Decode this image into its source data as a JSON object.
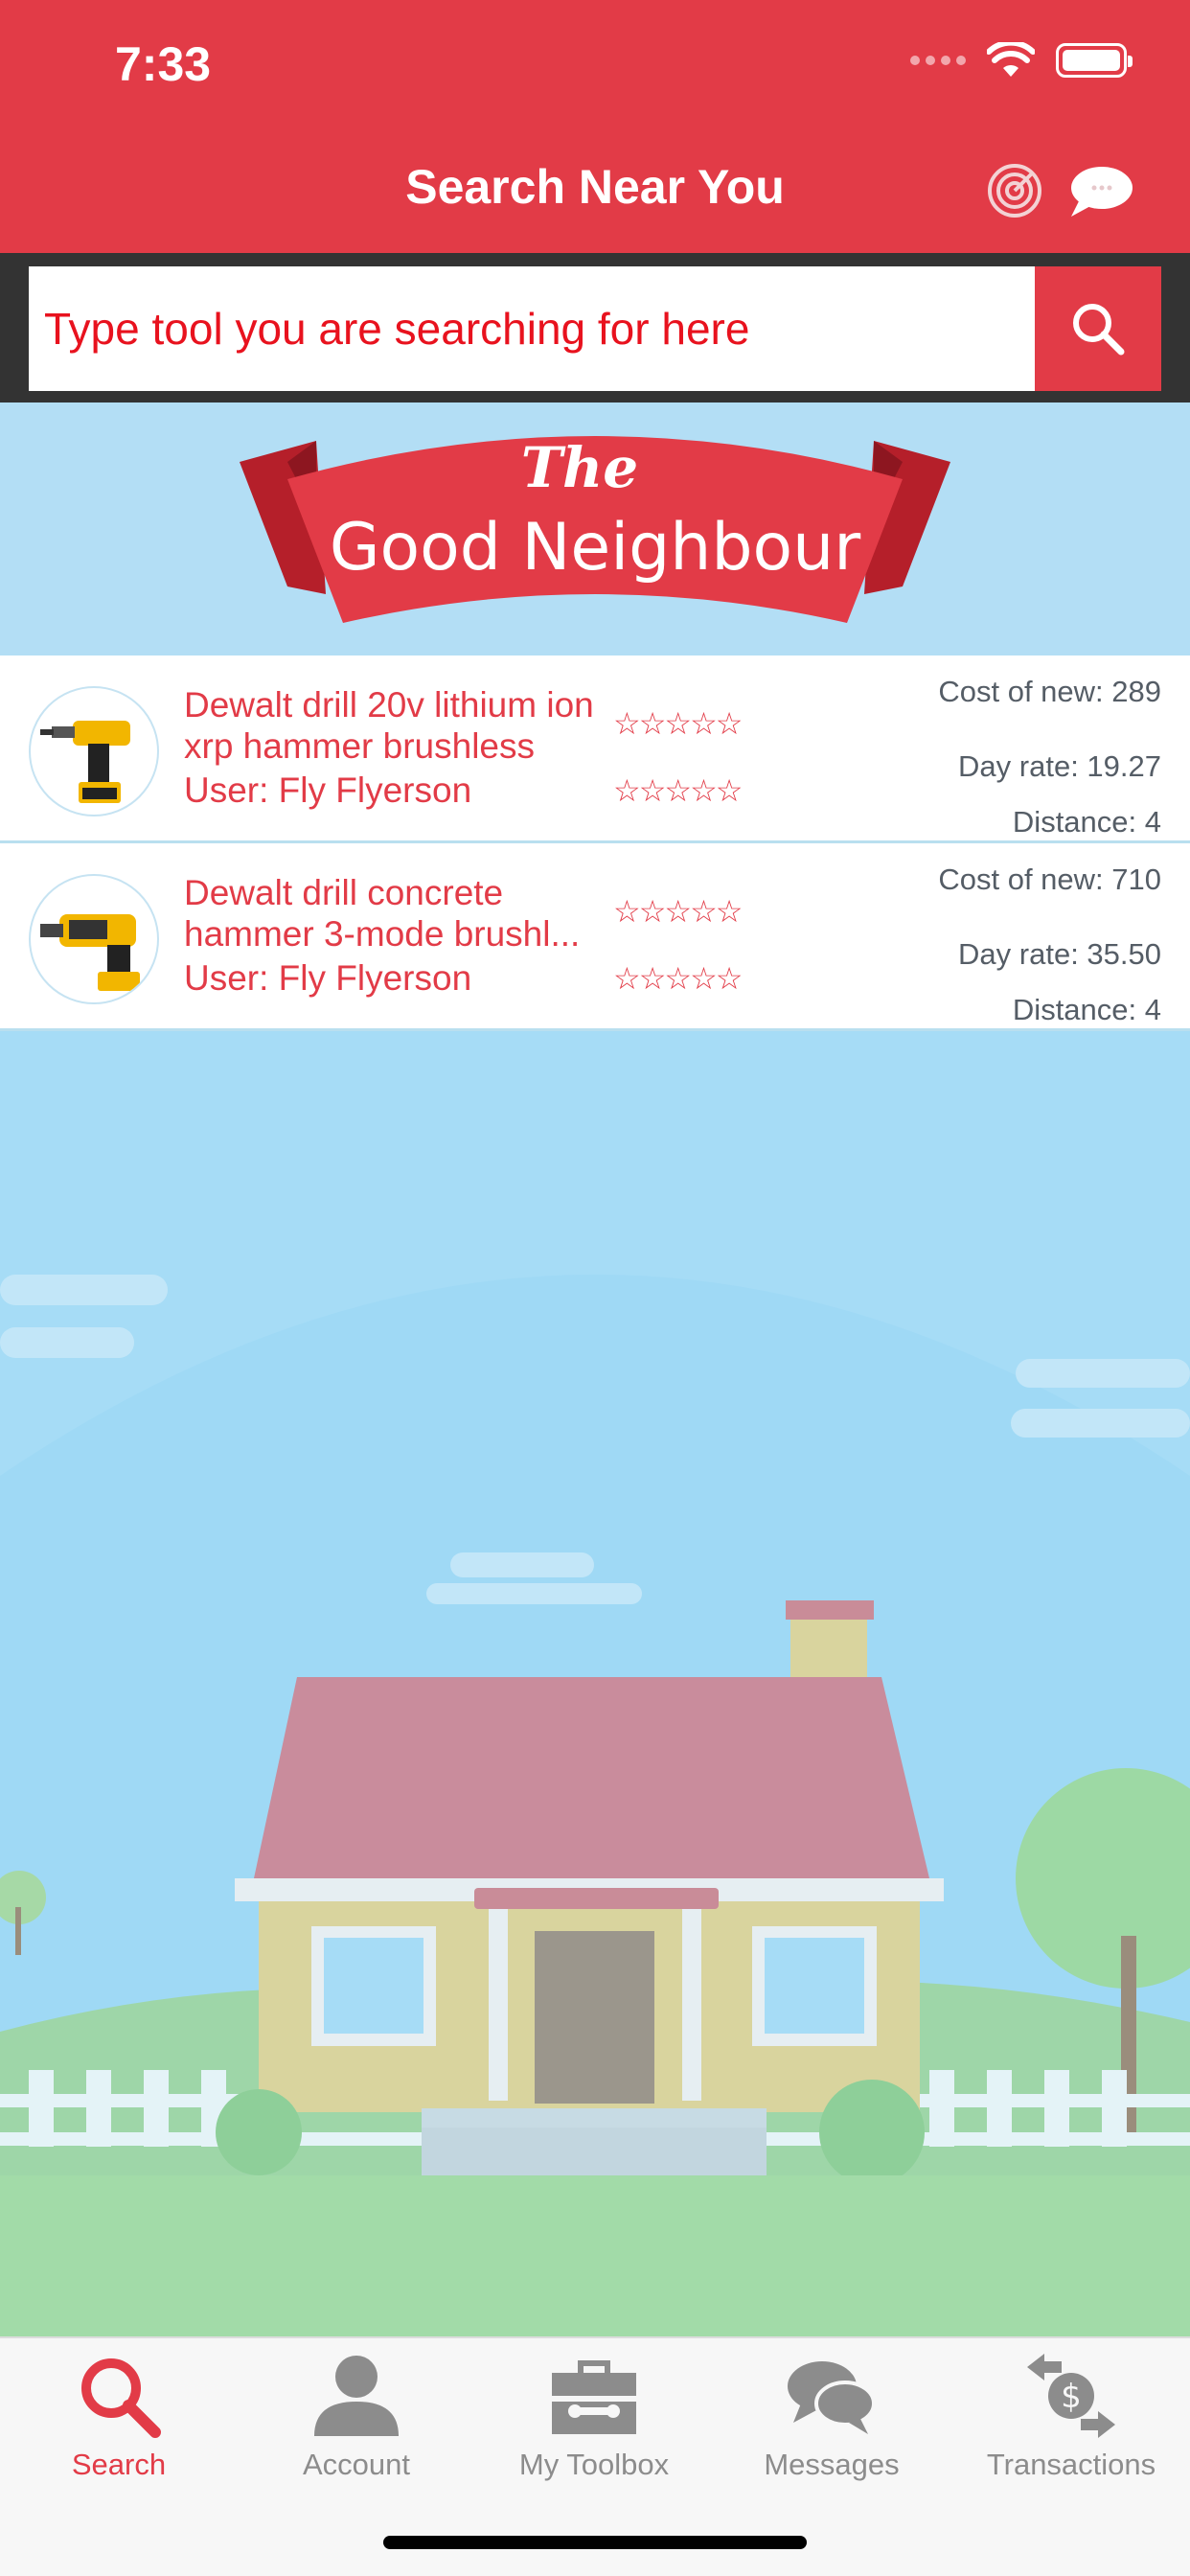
{
  "status_bar": {
    "time": "7:33"
  },
  "header": {
    "title": "Search Near You"
  },
  "search": {
    "placeholder": "Type tool you are searching for here"
  },
  "banner": {
    "line1": "The",
    "line2": "Good Neighbour"
  },
  "listings": [
    {
      "title": "Dewalt drill 20v lithium ion xrp hammer brushless",
      "user": "User: Fly Flyerson",
      "stars1": "☆☆☆☆☆",
      "stars2": "☆☆☆☆☆",
      "cost_of_new": "Cost of new: 289",
      "day_rate": "Day rate: 19.27",
      "distance": "Distance: 4"
    },
    {
      "title": "Dewalt drill concrete hammer 3-mode brushl...",
      "user": "User: Fly Flyerson",
      "stars1": "☆☆☆☆☆",
      "stars2": "☆☆☆☆☆",
      "cost_of_new": "Cost of new: 710",
      "day_rate": "Day rate: 35.50",
      "distance": "Distance: 4"
    }
  ],
  "tabs": [
    {
      "label": "Search",
      "icon": "search-icon",
      "active": true
    },
    {
      "label": "Account",
      "icon": "person-icon",
      "active": false
    },
    {
      "label": "My Toolbox",
      "icon": "toolbox-icon",
      "active": false
    },
    {
      "label": "Messages",
      "icon": "chat-bubbles-icon",
      "active": false
    },
    {
      "label": "Transactions",
      "icon": "exchange-dollar-icon",
      "active": false
    }
  ],
  "colors": {
    "brand_red": "#e23b47",
    "search_text": "#e8121e",
    "inactive_tab": "#8c8c8c",
    "sky": "#a6dcf6"
  }
}
